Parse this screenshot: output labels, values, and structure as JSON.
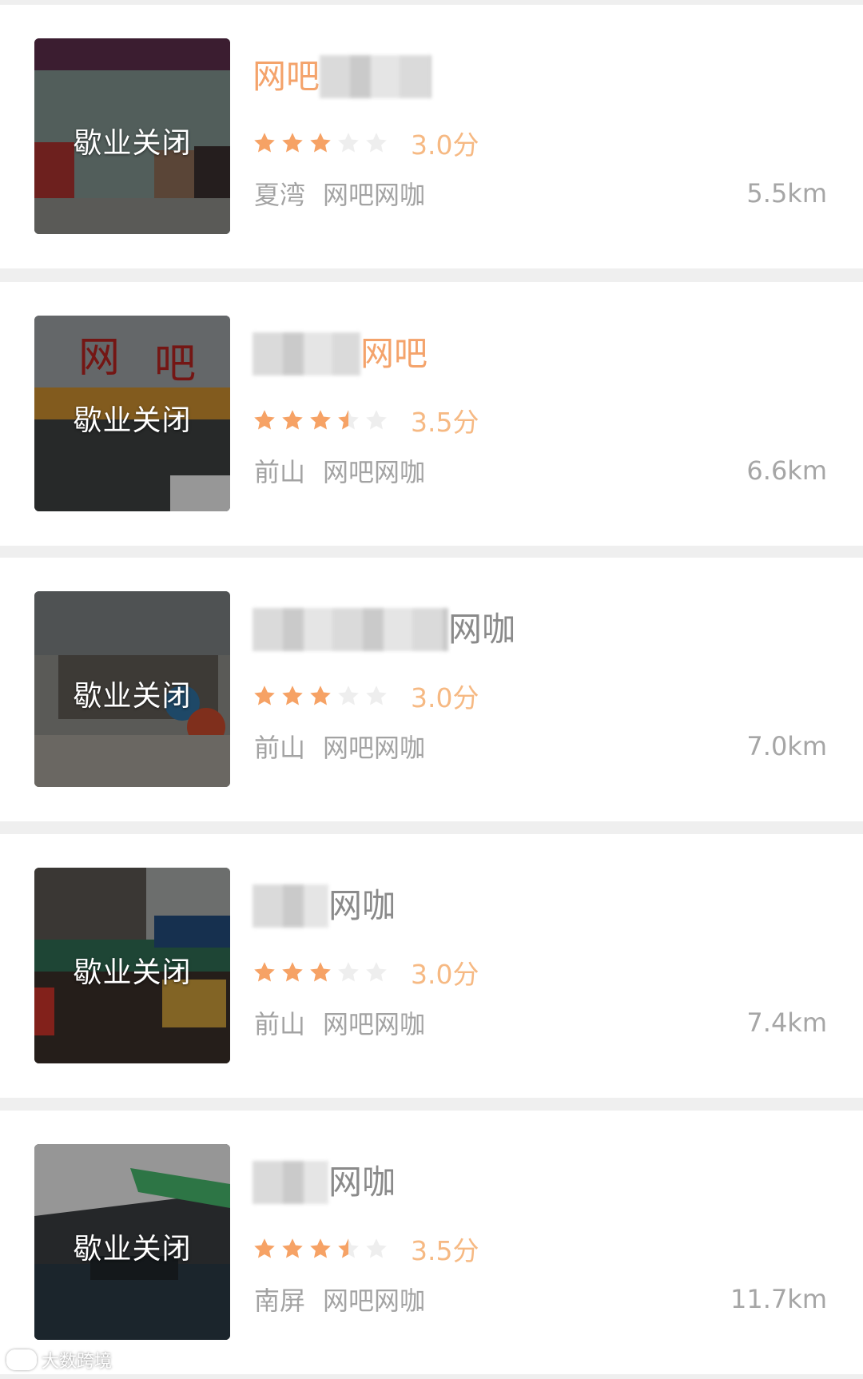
{
  "closed_label": "歇业关闭",
  "watermark": "大数跨境",
  "colors": {
    "accent": "#f4a36b",
    "star_on": "#f6a265",
    "star_off": "#eeeeee",
    "score": "#f6b983",
    "meta": "#a3a3a3"
  },
  "listings": [
    {
      "name_visible": "网吧",
      "name_suffix_blurred": true,
      "name_color": "orange",
      "rating": 3.0,
      "score_text": "3.0分",
      "area": "夏湾",
      "category": "网吧网咖",
      "distance": "5.5km",
      "photo_scene": "storefront-glass-door"
    },
    {
      "name_visible": "网吧",
      "name_prefix_blurred": true,
      "name_color": "orange",
      "rating": 3.5,
      "score_text": "3.5分",
      "area": "前山",
      "category": "网吧网咖",
      "distance": "6.6km",
      "photo_scene": "storefront-red-sign"
    },
    {
      "name_visible": "网咖",
      "name_prefix_blurred": true,
      "name_color": "gray",
      "rating": 3.0,
      "score_text": "3.0分",
      "area": "前山",
      "category": "网吧网咖",
      "distance": "7.0km",
      "photo_scene": "street-shopfront"
    },
    {
      "name_visible": "网咖",
      "name_prefix_blurred": true,
      "name_color": "gray",
      "rating": 3.0,
      "score_text": "3.0分",
      "area": "前山",
      "category": "网吧网咖",
      "distance": "7.4km",
      "photo_scene": "storefront-signboards"
    },
    {
      "name_visible": "网咖",
      "name_prefix_blurred": true,
      "name_color": "gray",
      "rating": 3.5,
      "score_text": "3.5分",
      "area": "南屏",
      "category": "网吧网咖",
      "distance": "11.7km",
      "photo_scene": "interior-gaming-hall"
    }
  ]
}
